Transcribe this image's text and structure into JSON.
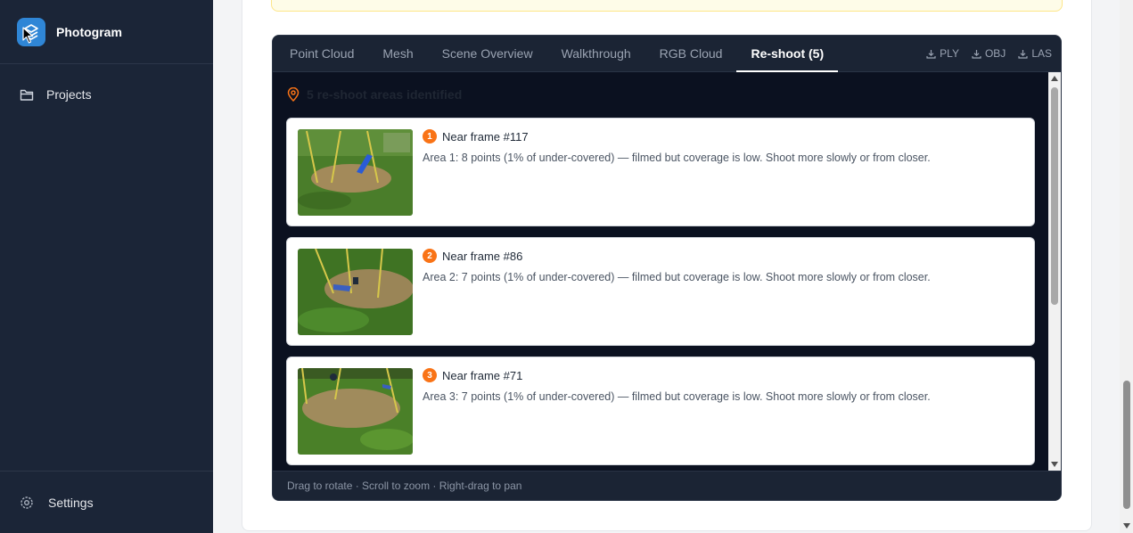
{
  "app": {
    "name": "Photogram"
  },
  "sidebar": {
    "items": [
      {
        "label": "Projects",
        "icon": "folder-icon"
      }
    ],
    "settings_label": "Settings"
  },
  "viewer": {
    "tabs": [
      {
        "label": "Point Cloud",
        "active": false
      },
      {
        "label": "Mesh",
        "active": false
      },
      {
        "label": "Scene Overview",
        "active": false
      },
      {
        "label": "Walkthrough",
        "active": false
      },
      {
        "label": "RGB Cloud",
        "active": false
      },
      {
        "label": "Re-shoot (5)",
        "active": true
      }
    ],
    "downloads": [
      "PLY",
      "OBJ",
      "LAS"
    ],
    "header": "5 re-shoot areas identified",
    "items": [
      {
        "number": "1",
        "title": "Near frame #117",
        "description": "Area 1: 8 points (1% of under-covered) — filmed but coverage is low. Shoot more slowly or from closer."
      },
      {
        "number": "2",
        "title": "Near frame #86",
        "description": "Area 2: 7 points (1% of under-covered) — filmed but coverage is low. Shoot more slowly or from closer."
      },
      {
        "number": "3",
        "title": "Near frame #71",
        "description": "Area 3: 7 points (1% of under-covered) — filmed but coverage is low. Shoot more slowly or from closer."
      }
    ],
    "footer": "Drag to rotate · Scroll to zoom · Right-drag to pan"
  },
  "colors": {
    "sidebar": "#1b2537",
    "accent": "#f97316",
    "logo": "#2f86d6"
  }
}
